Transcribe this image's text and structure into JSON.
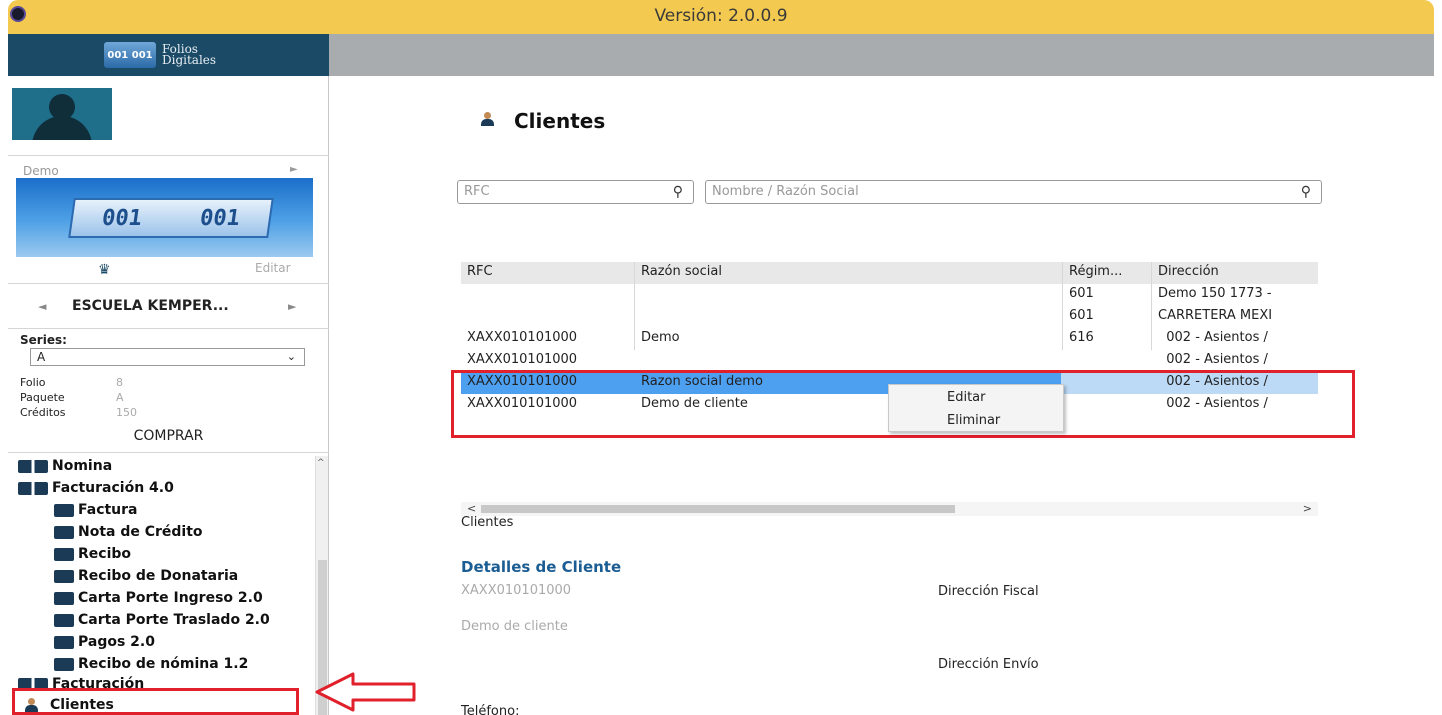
{
  "window": {
    "version": "Versión: 2.0.0.9"
  },
  "brand": {
    "logo_line1": "Folios",
    "logo_line2": "Digitales",
    "logo_cube": "001 001"
  },
  "sidebar": {
    "profile_name": "Demo",
    "product_digits": [
      "001",
      "001"
    ],
    "edit_label": "Editar",
    "company_name": "ESCUELA KEMPER...",
    "series_label": "Series:",
    "series_value": "A",
    "folio_label": "Folio",
    "folio_value": "8",
    "package_label": "Paquete",
    "package_value": "A",
    "credits_label": "Créditos",
    "credits_value": "150",
    "buy_label": "COMPRAR",
    "menu": [
      {
        "label": "Nomina",
        "level": 0,
        "icon": "folder-stack-icon"
      },
      {
        "label": "Facturación 4.0",
        "level": 0,
        "icon": "folder-double-icon"
      },
      {
        "label": "Factura",
        "level": 1,
        "icon": "folder-icon"
      },
      {
        "label": "Nota de Crédito",
        "level": 1,
        "icon": "folder-icon"
      },
      {
        "label": "Recibo",
        "level": 1,
        "icon": "folder-icon"
      },
      {
        "label": "Recibo de Donataria",
        "level": 1,
        "icon": "folder-icon"
      },
      {
        "label": "Carta Porte Ingreso 2.0",
        "level": 1,
        "icon": "folder-icon"
      },
      {
        "label": "Carta Porte Traslado 2.0",
        "level": 1,
        "icon": "folder-icon"
      },
      {
        "label": "Pagos 2.0",
        "level": 1,
        "icon": "folder-icon"
      },
      {
        "label": "Recibo de nómina 1.2",
        "level": 1,
        "icon": "folder-icon"
      },
      {
        "label": "Facturación",
        "level": 0,
        "icon": "folder-double-icon"
      },
      {
        "label": "Clientes",
        "level": 0,
        "icon": "client-icon"
      }
    ]
  },
  "main": {
    "title": "Clientes",
    "search_rfc_placeholder": "RFC",
    "search_name_placeholder": "Nombre  / Razón Social",
    "columns": [
      "RFC",
      "Razón social",
      "Régim...",
      "Dirección"
    ],
    "rows": [
      {
        "rfc": "",
        "name": "",
        "regimen": "601",
        "direccion": "Demo 150  1773 -"
      },
      {
        "rfc": "",
        "name": "",
        "regimen": "601",
        "direccion": "CARRETERA MEXI"
      },
      {
        "rfc": "XAXX010101000",
        "name": "Demo",
        "regimen": "616",
        "direccion": "  002 - Asientos /"
      },
      {
        "rfc": "XAXX010101000",
        "name": "",
        "regimen": "",
        "direccion": "  002 - Asientos /"
      },
      {
        "rfc": "XAXX010101000",
        "name": "Razon social demo",
        "regimen": "",
        "direccion": "  002 - Asientos /"
      },
      {
        "rfc": "XAXX010101000",
        "name": "Demo de cliente",
        "regimen": "",
        "direccion": "  002 - Asientos /"
      }
    ],
    "context_menu": [
      "Editar",
      "Eliminar"
    ],
    "grid_caption": "Clientes",
    "details": {
      "title": "Detalles de Cliente",
      "rfc": "XAXX010101000",
      "name": "Demo de cliente",
      "fiscal_address_label": "Dirección Fiscal",
      "shipping_address_label": "Dirección Envío",
      "phone_label": "Teléfono:"
    }
  },
  "colors": {
    "titlebar": "#f3c94f",
    "header": "#1a4a66",
    "highlight": "#e0202a",
    "selection": "#4d9ff0",
    "details_title": "#1b5d93"
  }
}
